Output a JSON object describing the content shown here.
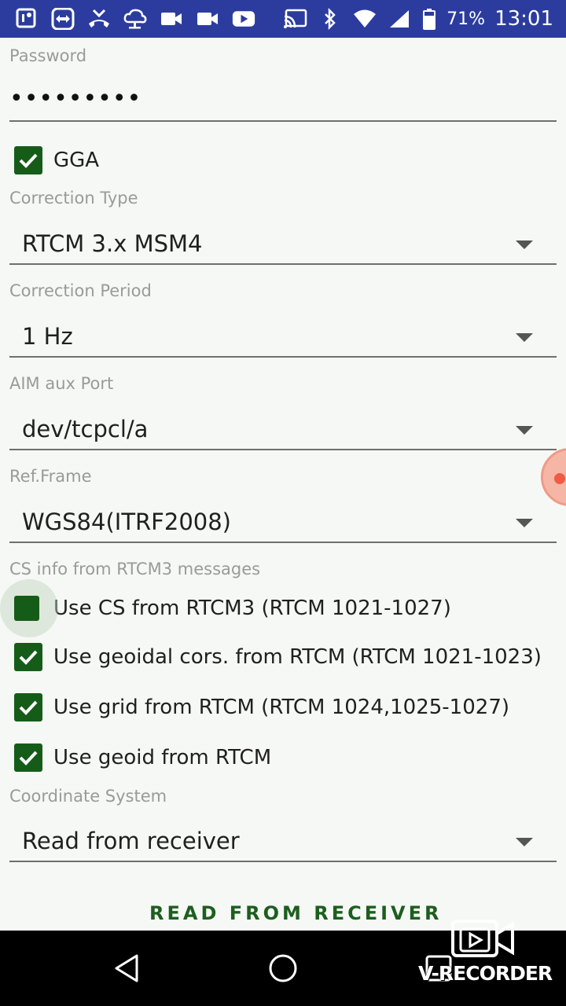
{
  "status_bar": {
    "battery": "71%",
    "time": "13:01",
    "icons": [
      "notification-icon",
      "teamviewer-icon",
      "phone-missed-icon",
      "ftp-icon",
      "video-icon",
      "video-icon-2",
      "youtube-icon",
      "cast-icon",
      "bluetooth-icon",
      "wifi-icon",
      "signal-icon",
      "battery-icon"
    ]
  },
  "form": {
    "password": {
      "label": "Password",
      "value": "•••••••••"
    },
    "gga": {
      "label": "GGA",
      "checked": true
    },
    "correction_type": {
      "label": "Correction Type",
      "value": "RTCM 3.x MSM4"
    },
    "correction_period": {
      "label": "Correction Period",
      "value": "1 Hz"
    },
    "aim_aux_port": {
      "label": "AIM aux Port",
      "value": "dev/tcpcl/a"
    },
    "ref_frame": {
      "label": "Ref.Frame",
      "value": "WGS84(ITRF2008)"
    },
    "cs_info": {
      "label": "CS info from RTCM3 messages",
      "options": [
        {
          "label": "Use CS from RTCM3 (RTCM 1021-1027)",
          "checked": false
        },
        {
          "label": "Use geoidal cors. from RTCM (RTCM 1021-1023)",
          "checked": true
        },
        {
          "label": "Use grid from RTCM (RTCM 1024,1025-1027)",
          "checked": true
        },
        {
          "label": "Use geoid from RTCM",
          "checked": true
        }
      ]
    },
    "coordinate_system": {
      "label": "Coordinate System",
      "value": "Read from receiver"
    },
    "read_button": "READ FROM RECEIVER"
  },
  "watermark": "V-RECORDER",
  "colors": {
    "status_bar": "#2c3c9e",
    "accent": "#165c19",
    "background": "#f6f8f5"
  }
}
